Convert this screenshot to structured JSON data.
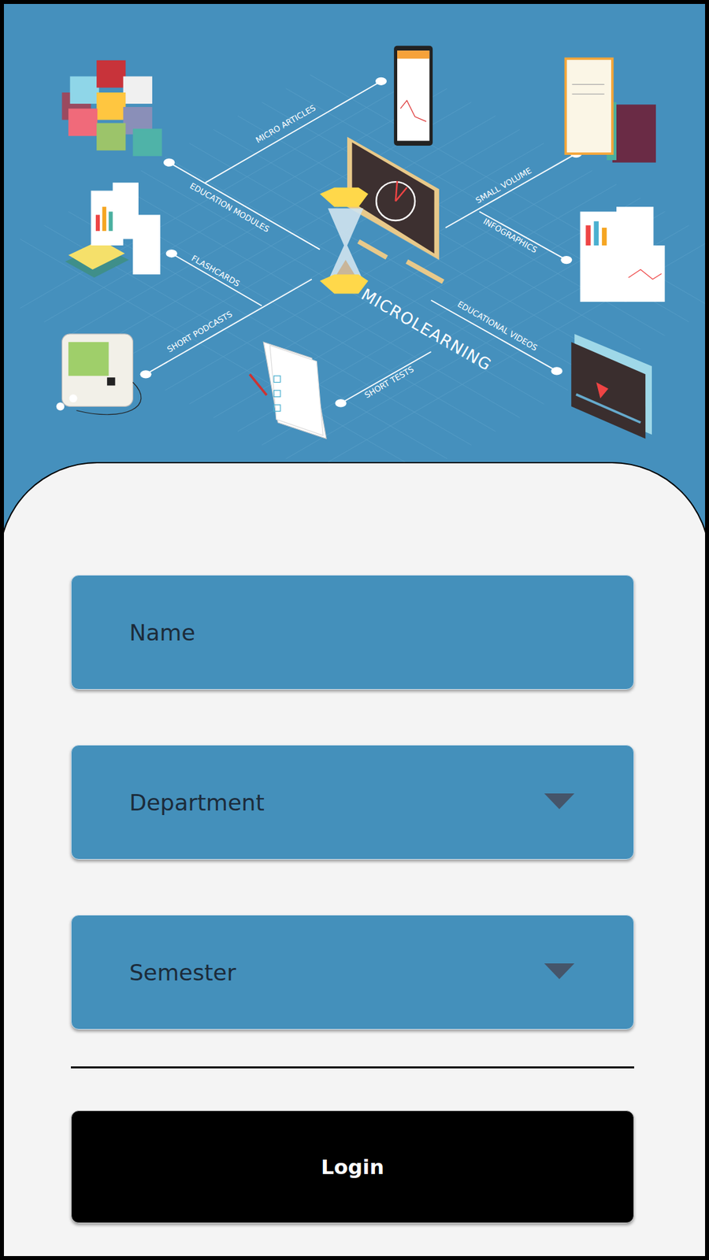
{
  "hero": {
    "title": "MICROLEARNING",
    "labels": [
      "MICRO ARTICLES",
      "EDUCATION MODULES",
      "FLASHCARDS",
      "SHORT PODCASTS",
      "SHORT TESTS",
      "SMALL VOLUME",
      "INFOGRAPHICS",
      "EDUCATIONAL VIDEOS"
    ]
  },
  "form": {
    "fields": [
      {
        "label": "Name",
        "kind": "text"
      },
      {
        "label": "Department",
        "kind": "select"
      },
      {
        "label": "Semester",
        "kind": "select"
      }
    ],
    "button": "Login"
  }
}
